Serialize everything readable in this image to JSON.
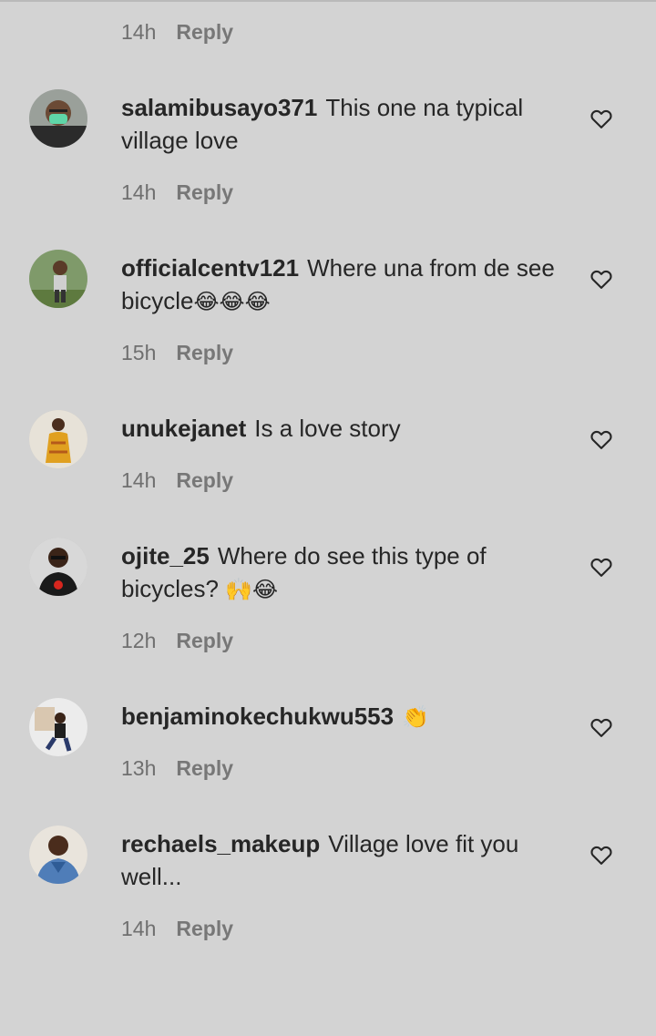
{
  "top_meta": {
    "time": "14h",
    "reply": "Reply"
  },
  "comments": [
    {
      "username": "salamibusayo371",
      "text": "This one na typical village love",
      "emoji": "",
      "time": "14h",
      "reply": "Reply",
      "avatar": "avatar-man-mask"
    },
    {
      "username": "officialcentv121",
      "text": "Where una from de see bicycle",
      "emoji": "😂😂😂",
      "time": "15h",
      "reply": "Reply",
      "avatar": "avatar-man-outdoor"
    },
    {
      "username": "unukejanet",
      "text": "Is a love story",
      "emoji": "",
      "time": "14h",
      "reply": "Reply",
      "avatar": "avatar-woman-yellow"
    },
    {
      "username": "ojite_25",
      "text": "Where do see this type of bicycles? ",
      "emoji": "🙌😂",
      "time": "12h",
      "reply": "Reply",
      "avatar": "avatar-man-jersey"
    },
    {
      "username": "benjaminokechukwu553",
      "text": "",
      "emoji": "👏",
      "time": "13h",
      "reply": "Reply",
      "avatar": "avatar-man-sitting"
    },
    {
      "username": "rechaels_makeup",
      "text": "Village love fit you well...",
      "emoji": "",
      "time": "14h",
      "reply": "Reply",
      "avatar": "avatar-woman-denim"
    }
  ]
}
